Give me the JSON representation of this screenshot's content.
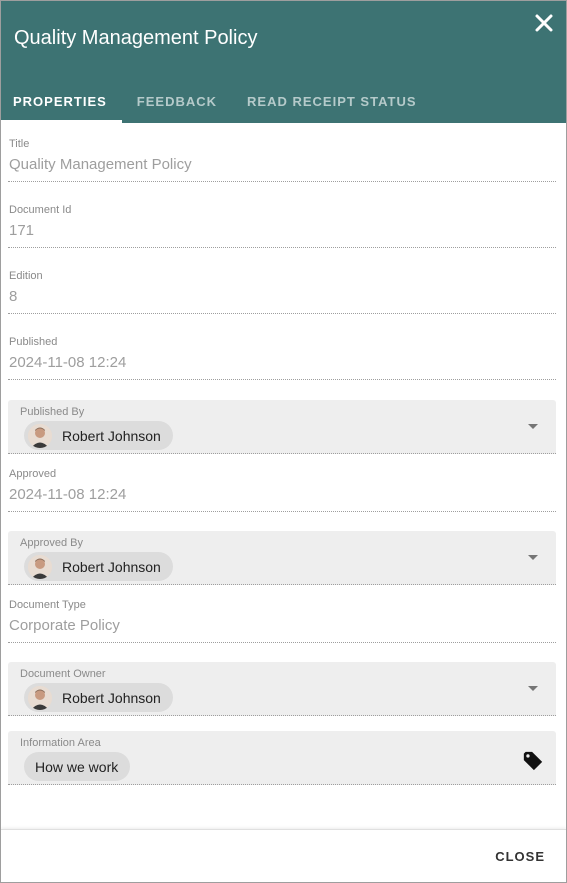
{
  "dialog": {
    "title": "Quality Management Policy"
  },
  "tabs": [
    "PROPERTIES",
    "FEEDBACK",
    "READ RECEIPT STATUS"
  ],
  "fields": {
    "title": {
      "label": "Title",
      "value": "Quality Management Policy"
    },
    "document_id": {
      "label": "Document Id",
      "value": "171"
    },
    "edition": {
      "label": "Edition",
      "value": "8"
    },
    "published": {
      "label": "Published",
      "value": "2024-11-08 12:24"
    },
    "published_by": {
      "label": "Published By",
      "value": "Robert Johnson"
    },
    "approved": {
      "label": "Approved",
      "value": "2024-11-08 12:24"
    },
    "approved_by": {
      "label": "Approved By",
      "value": "Robert Johnson"
    },
    "document_type": {
      "label": "Document Type",
      "value": "Corporate Policy"
    },
    "document_owner": {
      "label": "Document Owner",
      "value": "Robert Johnson"
    },
    "information_area": {
      "label": "Information Area",
      "value": "How we work"
    }
  },
  "footer": {
    "close_label": "CLOSE"
  },
  "colors": {
    "header": "#3d7373",
    "field_bg": "#eeeeee",
    "chip_bg": "#dcdcdc"
  },
  "icons": {
    "close": "close-icon",
    "dropdown": "chevron-down-icon",
    "tag": "tag-icon",
    "avatar": "avatar"
  }
}
